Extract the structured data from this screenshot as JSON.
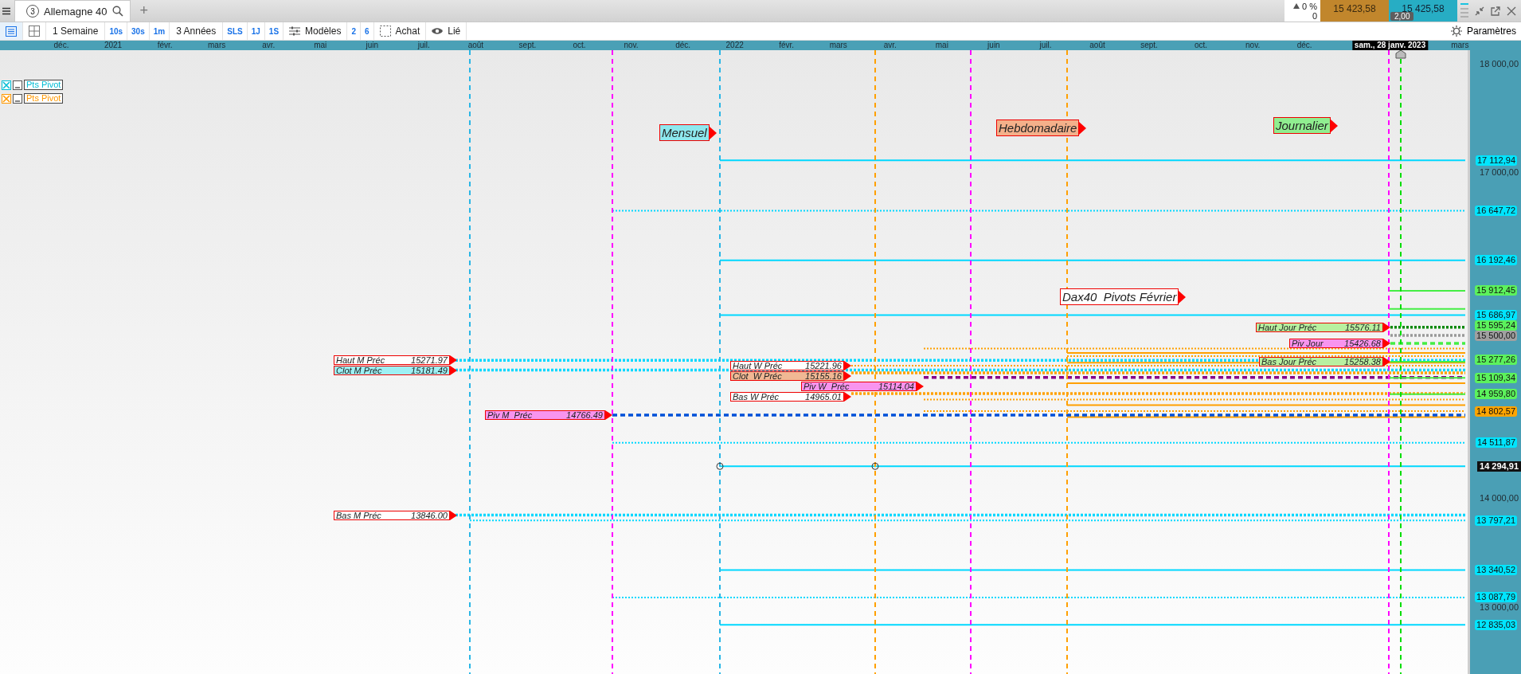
{
  "tab_bar": {
    "tabs": [
      {
        "number": "3",
        "label": "Allemagne 40",
        "selected": true
      }
    ],
    "new_tab": "+"
  },
  "quote": {
    "change": "0 %",
    "change_value": "0",
    "bid": "15 423,58",
    "ask": "15 425,58",
    "spread": "2,00"
  },
  "toolbar": {
    "items": [
      {
        "kind": "period",
        "label": "1 Semaine"
      },
      {
        "kind": "quick",
        "label": "10s"
      },
      {
        "kind": "quick",
        "label": "30s"
      },
      {
        "kind": "quick",
        "label": "1m"
      },
      {
        "kind": "period",
        "label": "3 Années"
      },
      {
        "kind": "quick",
        "label": "SLS"
      },
      {
        "kind": "quick",
        "label": "1J"
      },
      {
        "kind": "quick",
        "label": "1S"
      },
      {
        "kind": "templates",
        "label": "Modèles"
      },
      {
        "kind": "quick",
        "label": "2"
      },
      {
        "kind": "quick",
        "label": "6"
      },
      {
        "kind": "order",
        "label": "Achat"
      },
      {
        "kind": "link",
        "label": "Lié"
      }
    ],
    "settings": "Paramètres"
  },
  "timeline": {
    "labels": [
      {
        "text": "déc.",
        "kind": "month"
      },
      {
        "text": "2021",
        "kind": "year"
      },
      {
        "text": "févr.",
        "kind": "month"
      },
      {
        "text": "mars",
        "kind": "month"
      },
      {
        "text": "avr.",
        "kind": "month"
      },
      {
        "text": "mai",
        "kind": "month"
      },
      {
        "text": "juin",
        "kind": "month"
      },
      {
        "text": "juil.",
        "kind": "month"
      },
      {
        "text": "août",
        "kind": "month"
      },
      {
        "text": "sept.",
        "kind": "month"
      },
      {
        "text": "oct.",
        "kind": "month"
      },
      {
        "text": "nov.",
        "kind": "month"
      },
      {
        "text": "déc.",
        "kind": "month"
      },
      {
        "text": "2022",
        "kind": "year"
      },
      {
        "text": "févr.",
        "kind": "month"
      },
      {
        "text": "mars",
        "kind": "month"
      },
      {
        "text": "avr.",
        "kind": "month"
      },
      {
        "text": "mai",
        "kind": "month"
      },
      {
        "text": "juin",
        "kind": "month"
      },
      {
        "text": "juil.",
        "kind": "month"
      },
      {
        "text": "août",
        "kind": "month"
      },
      {
        "text": "sept.",
        "kind": "month"
      },
      {
        "text": "oct.",
        "kind": "month"
      },
      {
        "text": "nov.",
        "kind": "month"
      },
      {
        "text": "déc.",
        "kind": "month"
      },
      {
        "text": "sam., 28 janv. 2023",
        "kind": "cursor"
      },
      {
        "text": "mars",
        "kind": "month"
      }
    ]
  },
  "legend": [
    {
      "label": "Pts Pivot",
      "color": "#00bcd4"
    },
    {
      "label": "Pts Pivot",
      "color": "#ff9800"
    }
  ],
  "annotations": [
    {
      "text": "Mensuel",
      "kind": "monthly",
      "color": "#8ee8ee"
    },
    {
      "text": "Hebdomadaire",
      "kind": "weekly",
      "color": "#f4b08a"
    },
    {
      "text": "Journalier",
      "kind": "daily",
      "color": "#90ee90"
    },
    {
      "text": "Dax40  Pivots Février",
      "kind": "title",
      "color": "#ffffff"
    }
  ],
  "level_labels": {
    "monthly": [
      {
        "kind": "high",
        "name": "Haut M Préc",
        "value": "15271.97",
        "color": "#ffffff"
      },
      {
        "kind": "close",
        "name": "Clot M Préc",
        "value": "15181.49",
        "color": "#9ef0f4"
      },
      {
        "kind": "pivot",
        "name": "Piv M  Préc",
        "value": "14766.49",
        "color": "#f894ee"
      },
      {
        "kind": "low",
        "name": "Bas M Préc",
        "value": "13846.00",
        "color": "#ffffff"
      }
    ],
    "weekly": [
      {
        "kind": "high",
        "name": "Haut W Préc",
        "value": "15221.96",
        "color": "#ffffff"
      },
      {
        "kind": "close",
        "name": "Clot  W Préc",
        "value": "15155.16",
        "color": "#f0b894"
      },
      {
        "kind": "pivot",
        "name": "Piv W  Préc",
        "value": "15114.04",
        "color": "#f894ee"
      },
      {
        "kind": "low",
        "name": "Bas W Préc",
        "value": "14965.01",
        "color": "#ffffff"
      }
    ],
    "daily": [
      {
        "kind": "high",
        "name": "Haut Jour Préc",
        "value": "15576.11",
        "color": "#b8f0a0"
      },
      {
        "kind": "pivot",
        "name": "Piv Jour",
        "value": "15426.68",
        "color": "#f894ee"
      },
      {
        "kind": "low",
        "name": "Bas Jour Préc",
        "value": "15258.38",
        "color": "#b8f0a0"
      }
    ]
  },
  "price_axis": [
    {
      "text": "18 000,00",
      "kind": "grid"
    },
    {
      "text": "17 112,94",
      "kind": "tag",
      "color": "#00e5ff"
    },
    {
      "text": "17 000,00",
      "kind": "grid"
    },
    {
      "text": "16 647,72",
      "kind": "tag",
      "color": "#00e5ff"
    },
    {
      "text": "16 192,46",
      "kind": "tag",
      "color": "#00e5ff"
    },
    {
      "text": "15 912,45",
      "kind": "tag",
      "color": "#5cf25c"
    },
    {
      "text": "15 686,97",
      "kind": "tag",
      "color": "#00e5ff"
    },
    {
      "text": "15 595,24",
      "kind": "tag",
      "color": "#5cf25c"
    },
    {
      "text": "15 500,00",
      "kind": "tag",
      "color": "#a0a0a0"
    },
    {
      "text": "15 277,26",
      "kind": "tag",
      "color": "#5cf25c"
    },
    {
      "text": "15 109,34",
      "kind": "tag",
      "color": "#5cf25c"
    },
    {
      "text": "14 959,80",
      "kind": "tag",
      "color": "#5cf25c"
    },
    {
      "text": "14 802,57",
      "kind": "tag",
      "color": "#ffa500"
    },
    {
      "text": "14 511,87",
      "kind": "tag",
      "color": "#00e5ff"
    },
    {
      "text": "14 294,91",
      "kind": "last"
    },
    {
      "text": "14 000,00",
      "kind": "grid"
    },
    {
      "text": "13 797,21",
      "kind": "tag",
      "color": "#00e5ff"
    },
    {
      "text": "13 340,52",
      "kind": "tag",
      "color": "#00e5ff"
    },
    {
      "text": "13 087,79",
      "kind": "tag",
      "color": "#00e5ff"
    },
    {
      "text": "13 000,00",
      "kind": "grid"
    },
    {
      "text": "12 835,03",
      "kind": "tag",
      "color": "#00e5ff"
    }
  ]
}
